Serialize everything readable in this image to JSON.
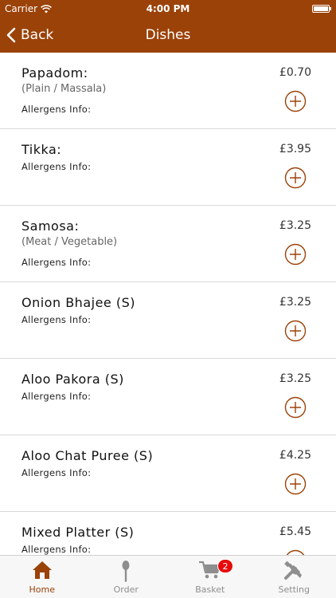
{
  "status_bar": {
    "carrier": "Carrier",
    "time": "4:00 PM",
    "battery_level": 1.0
  },
  "nav": {
    "back_label": "Back",
    "title": "Dishes"
  },
  "dishes": [
    {
      "name": "Papadom:",
      "variant": "(Plain / Massala)",
      "allergens": "Allergens Info:",
      "price": "£0.70"
    },
    {
      "name": "Tikka:",
      "variant": "",
      "allergens": "Allergens Info:",
      "price": "£3.95"
    },
    {
      "name": "Samosa:",
      "variant": "(Meat / Vegetable)",
      "allergens": "Allergens Info:",
      "price": "£3.25"
    },
    {
      "name": "Onion Bhajee (S)",
      "variant": "",
      "allergens": "Allergens Info:",
      "price": "£3.25"
    },
    {
      "name": "Aloo Pakora (S)",
      "variant": "",
      "allergens": "Allergens Info:",
      "price": "£3.25"
    },
    {
      "name": "Aloo Chat Puree (S)",
      "variant": "",
      "allergens": "Allergens Info:",
      "price": "£4.25"
    },
    {
      "name": "Mixed Platter (S)",
      "variant": "",
      "allergens": "Allergens Info:",
      "price": "£5.45"
    }
  ],
  "tabs": [
    {
      "label": "Home",
      "icon": "home-icon",
      "active": true
    },
    {
      "label": "Order",
      "icon": "spoon-icon",
      "active": false
    },
    {
      "label": "Basket",
      "icon": "cart-icon",
      "active": false,
      "badge": "2"
    },
    {
      "label": "Setting",
      "icon": "tools-icon",
      "active": false
    }
  ],
  "colors": {
    "brand": "#9b4208",
    "badge": "#e8090a",
    "inactive": "#8e8e8e"
  }
}
